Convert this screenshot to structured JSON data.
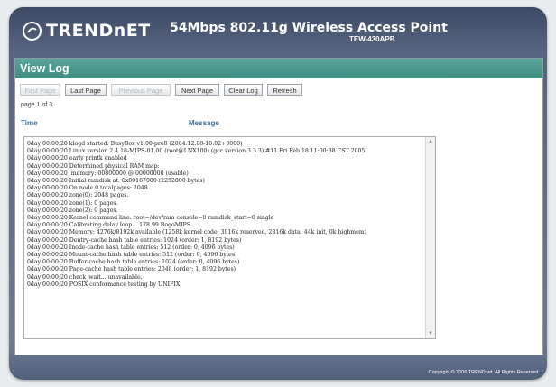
{
  "header": {
    "brand": "TRENDnET",
    "product_title": "54Mbps 802.11g Wireless Access Point",
    "model": "TEW-430APB"
  },
  "panel": {
    "title": "View Log",
    "buttons": [
      {
        "label": "First Page",
        "enabled": false
      },
      {
        "label": "Last Page",
        "enabled": true
      },
      {
        "label": "Previous Page",
        "enabled": false
      },
      {
        "label": "Next Page",
        "enabled": true
      },
      {
        "label": "Clear Log",
        "enabled": true
      },
      {
        "label": "Refresh",
        "enabled": true
      }
    ],
    "page_info": "page 1 of 3",
    "columns": {
      "time": "Time",
      "message": "Message"
    },
    "log_text": "0day 00:00:20 klogd started: BusyBox v1.00-pre8 (2004.12.08-10:02+0000)\n0day 00:00:20 Linux version 2.4.18-MIPS-01.00 (root@LNX100) (gcc version 3.3.3) #11 Fri Feb 18 11:00:38 CST 2005\n0day 00:00:20 early printk enabled\n0day 00:00:20 Determined physical RAM map:\n0day 00:00:20  memory: 00800000 @ 00000000 (usable)\n0day 00:00:20 Initial ramdisk at: 0x80167000 (2252800 bytes)\n0day 00:00:20 On node 0 totalpages: 2048\n0day 00:00:20 zone(0): 2048 pages.\n0day 00:00:20 zone(1): 0 pages.\n0day 00:00:20 zone(2): 0 pages.\n0day 00:00:20 Kernel command line: root=/dev/ram console=0 ramdisk_start=0 single\n0day 00:00:20 Calibrating delay loop... 178.99 BogoMIPS\n0day 00:00:20 Memory: 4276k/8192k available (1258k kernel code, 3916k reserved, 2316k data, 44k init, 0k highmem)\n0day 00:00:20 Dentry-cache hash table entries: 1024 (order: 1, 8192 bytes)\n0day 00:00:20 Inode-cache hash table entries: 512 (order: 0, 4096 bytes)\n0day 00:00:20 Mount-cache hash table entries: 512 (order: 0, 4096 bytes)\n0day 00:00:20 Buffer-cache hash table entries: 1024 (order: 0, 4096 bytes)\n0day 00:00:20 Page-cache hash table entries: 2048 (order: 1, 8192 bytes)\n0day 00:00:20 check_wait... unavailable.\n0day 00:00:20 POSIX conformance testing by UNIFIX"
  },
  "footer": {
    "copyright": "Copyright © 2006 TRENDnet. All Rights Reserved."
  },
  "colors": {
    "frame": "#56647f",
    "panel_title": "#4a988d",
    "column_header": "#3a6d9a"
  }
}
